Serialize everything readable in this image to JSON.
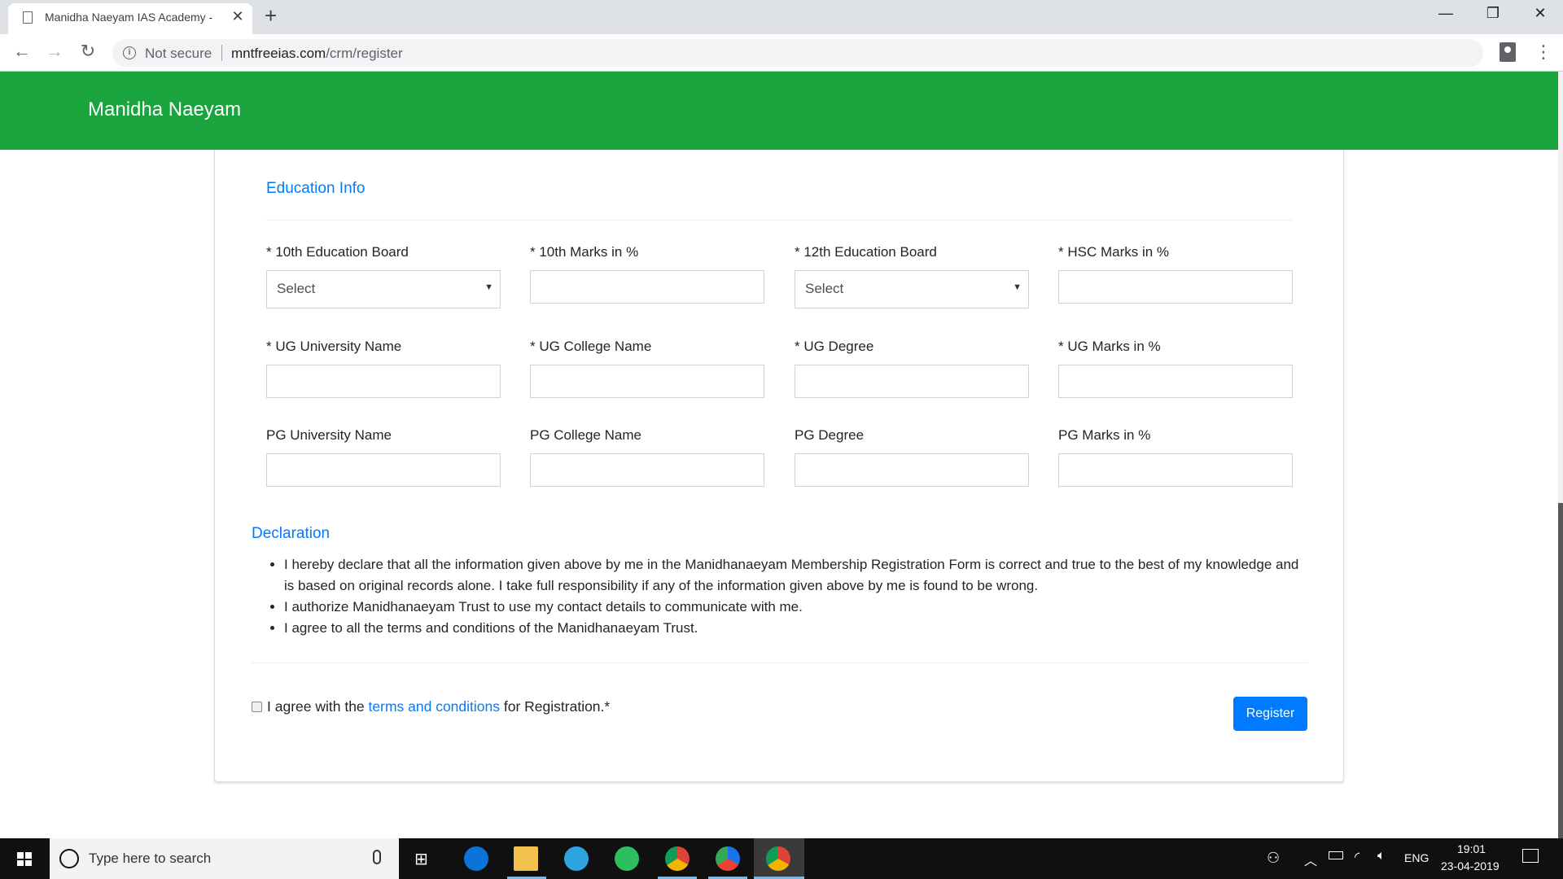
{
  "browser": {
    "tab_title": "Manidha Naeyam IAS Academy - ",
    "security_label": "Not secure",
    "url_host": "mntfreeias.com",
    "url_path": "/crm/register",
    "icons": {
      "tab": "document-icon",
      "close": "✕",
      "new_tab": "+",
      "back": "←",
      "forward": "→",
      "reload": "↻",
      "info": "i",
      "menu": "⋮",
      "minimize": "—",
      "restore": "❐",
      "window_close": "✕"
    }
  },
  "header": {
    "brand": "Manidha Naeyam"
  },
  "education": {
    "title": "Education Info",
    "fields": [
      {
        "label": "* 10th Education Board",
        "type": "select",
        "value": "Select"
      },
      {
        "label": "* 10th Marks in %",
        "type": "text",
        "value": ""
      },
      {
        "label": "* 12th Education Board",
        "type": "select",
        "value": "Select"
      },
      {
        "label": "* HSC Marks in %",
        "type": "text",
        "value": ""
      },
      {
        "label": "* UG University Name",
        "type": "text",
        "value": ""
      },
      {
        "label": "* UG College Name",
        "type": "text",
        "value": ""
      },
      {
        "label": "* UG Degree",
        "type": "text",
        "value": ""
      },
      {
        "label": "* UG Marks in %",
        "type": "text",
        "value": ""
      },
      {
        "label": "PG University Name",
        "type": "text",
        "value": ""
      },
      {
        "label": "PG College Name",
        "type": "text",
        "value": ""
      },
      {
        "label": "PG Degree",
        "type": "text",
        "value": ""
      },
      {
        "label": "PG Marks in %",
        "type": "text",
        "value": ""
      }
    ]
  },
  "declaration": {
    "title": "Declaration",
    "items": [
      "I hereby declare that all the information given above by me in the Manidhanaeyam Membership Registration Form is correct and true to the best of my knowledge and is based on original records alone. I take full responsibility if any of the information given above by me is found to be wrong.",
      "I authorize Manidhanaeyam Trust to use my contact details to communicate with me.",
      "I agree to all the terms and conditions of the Manidhanaeyam Trust."
    ]
  },
  "agreement": {
    "prefix": "I agree with the ",
    "link": "terms and conditions",
    "suffix": " for Registration.*",
    "checked": false
  },
  "register_button": "Register",
  "taskbar": {
    "search_placeholder": "Type here to search",
    "language": "ENG",
    "time": "19:01",
    "date": "23-04-2019"
  },
  "colors": {
    "brand_green": "#19a43d",
    "accent_blue": "#007bff"
  }
}
